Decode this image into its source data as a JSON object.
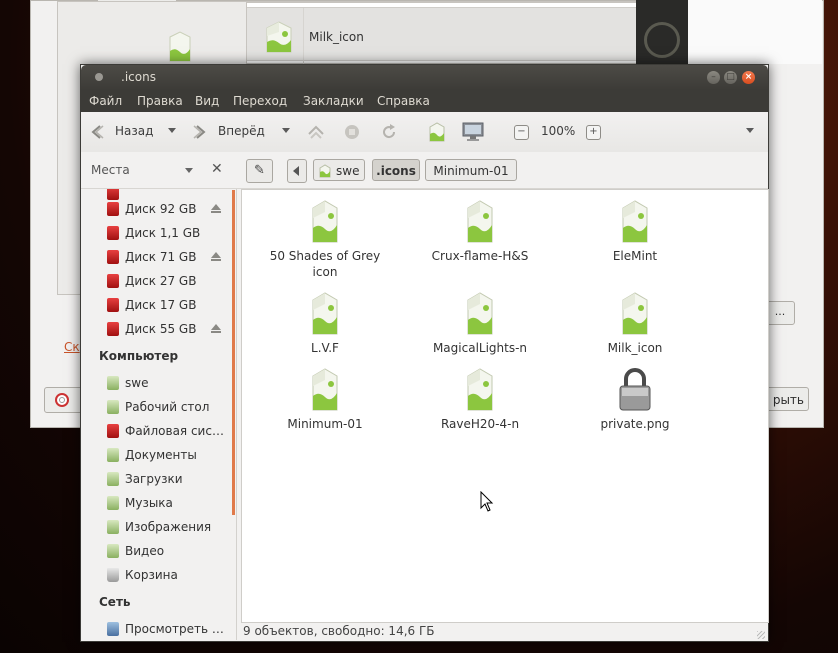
{
  "background_window": {
    "selected_row_label": "Milk_icon",
    "link_text": "Ск",
    "right_button_label": "рыть",
    "dots_button_label": "..."
  },
  "window": {
    "title": ".icons",
    "controls": [
      "–",
      "□",
      "×"
    ]
  },
  "menubar": [
    "Файл",
    "Правка",
    "Вид",
    "Переход",
    "Закладки",
    "Справка"
  ],
  "toolbar": {
    "back_label": "Назад",
    "forward_label": "Вперёд",
    "zoom_out": "−",
    "zoom_level": "100%",
    "zoom_in": "+"
  },
  "location": {
    "places_label": "Места",
    "path": [
      "swe",
      ".icons",
      "Minimum-01"
    ]
  },
  "sidebar": {
    "devices": [
      {
        "label": "Диск 92 GB",
        "eject": true
      },
      {
        "label": "Диск 1,1 GB",
        "eject": false
      },
      {
        "label": "Диск 71 GB",
        "eject": true
      },
      {
        "label": "Диск 27 GB",
        "eject": false
      },
      {
        "label": "Диск 17 GB",
        "eject": false
      },
      {
        "label": "Диск 55 GB",
        "eject": true
      }
    ],
    "computer_header": "Компьютер",
    "computer": [
      "swe",
      "Рабочий стол",
      "Файловая сис…",
      "Документы",
      "Загрузки",
      "Музыка",
      "Изображения",
      "Видео",
      "Корзина"
    ],
    "network_header": "Сеть",
    "network": [
      "Просмотреть …"
    ]
  },
  "files": [
    {
      "name": "50 Shades of Grey icon",
      "line1": "50 Shades of Grey",
      "line2": "icon",
      "type": "folder"
    },
    {
      "name": "Crux-flame-H&S",
      "line1": "Crux-flame-H&S",
      "line2": "",
      "type": "folder"
    },
    {
      "name": "EleMint",
      "line1": "EleMint",
      "line2": "",
      "type": "folder"
    },
    {
      "name": "L.V.F",
      "line1": "L.V.F",
      "line2": "",
      "type": "folder"
    },
    {
      "name": "MagicalLights-n",
      "line1": "MagicalLights-n",
      "line2": "",
      "type": "folder"
    },
    {
      "name": "Milk_icon",
      "line1": "Milk_icon",
      "line2": "",
      "type": "folder"
    },
    {
      "name": "Minimum-01",
      "line1": "Minimum-01",
      "line2": "",
      "type": "folder"
    },
    {
      "name": "RaveH20-4-n",
      "line1": "RaveH20-4-n",
      "line2": "",
      "type": "folder"
    },
    {
      "name": "private.png",
      "line1": "private.png",
      "line2": "",
      "type": "lock"
    }
  ],
  "status": "9 объектов, свободно: 14,6 ГБ"
}
